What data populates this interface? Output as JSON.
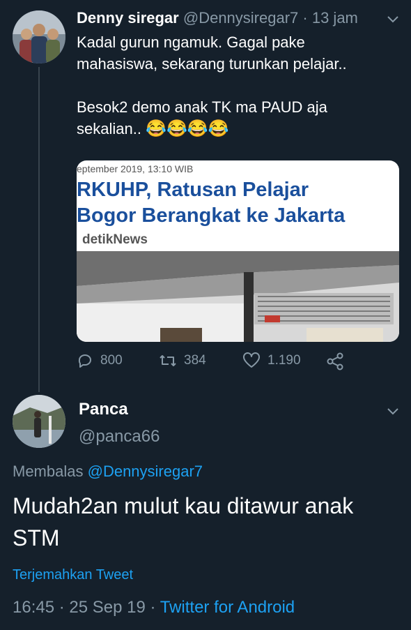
{
  "tweet1": {
    "author_name": "Denny siregar",
    "handle": "@Dennysiregar7",
    "separator": " · ",
    "time": "13 jam",
    "lines": [
      "Kadal gurun ngamuk. Gagal pake mahasiswa, sekarang turunkan pelajar..",
      "Besok2 demo anak TK ma PAUD aja sekalian.."
    ],
    "emoji": "😂😂😂😂",
    "card": {
      "date": "eptember 2019, 13:10 WIB",
      "title_line1": "RKUHP, Ratusan Pelajar",
      "title_line2": "Bogor Berangkat ke Jakarta",
      "source": "detikNews"
    },
    "actions": {
      "replies": "800",
      "retweets": "384",
      "likes": "1.190"
    }
  },
  "tweet2": {
    "author_name": "Panca",
    "handle": "@panca66",
    "reply_prefix": "Membalas",
    "reply_handle": "@Dennysiregar7",
    "text": "Mudah2an mulut kau ditawur anak STM",
    "translate_label": "Terjemahkan Tweet",
    "time": "16:45",
    "date_sep": " · ",
    "date": "25 Sep 19",
    "source_sep": " · ",
    "source": "Twitter for Android"
  },
  "colors": {
    "background": "#15202b",
    "muted": "#8899a6",
    "link": "#1da1f2",
    "card_title": "#1a4f9c"
  }
}
